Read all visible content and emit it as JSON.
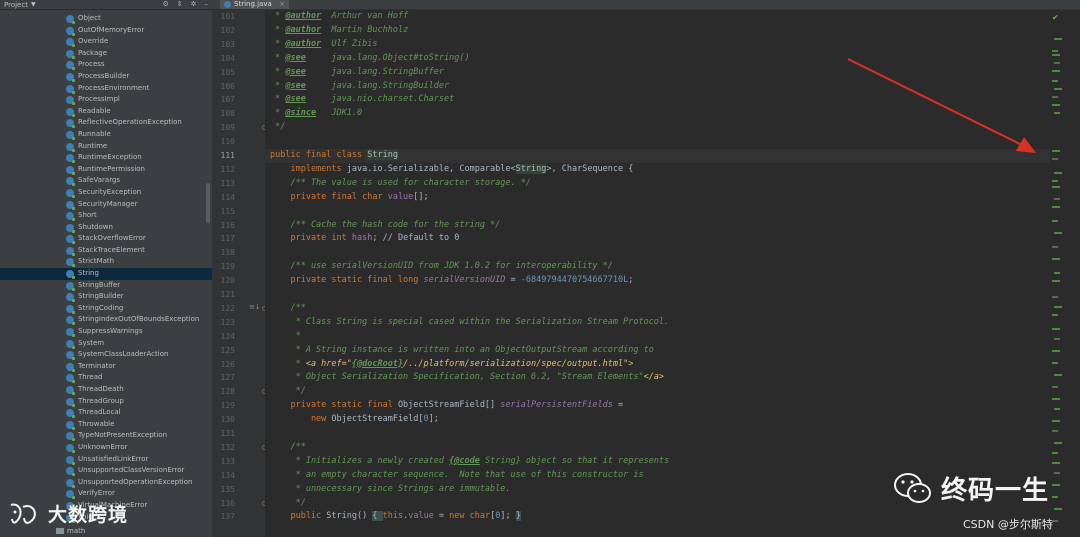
{
  "project": {
    "title": "Project",
    "tree_items": [
      "Object",
      "OutOfMemoryError",
      "Override",
      "Package",
      "Process",
      "ProcessBuilder",
      "ProcessEnvironment",
      "ProcessImpl",
      "Readable",
      "ReflectiveOperationException",
      "Runnable",
      "Runtime",
      "RuntimeException",
      "RuntimePermission",
      "SafeVarargs",
      "SecurityException",
      "SecurityManager",
      "Short",
      "Shutdown",
      "StackOverflowError",
      "StackTraceElement",
      "StrictMath",
      "String",
      "StringBuffer",
      "StringBuilder",
      "StringCoding",
      "StringIndexOutOfBoundsException",
      "SuppressWarnings",
      "System",
      "SystemClassLoaderAction",
      "Terminator",
      "Thread",
      "ThreadDeath",
      "ThreadGroup",
      "ThreadLocal",
      "Throwable",
      "TypeNotPresentException",
      "UnknownError",
      "UnsatisfiedLinkError",
      "UnsupportedClassVersionError",
      "UnsupportedOperationException",
      "VerifyError",
      "VirtualMachineError",
      "Void"
    ],
    "selected": "String",
    "folder_math": "math"
  },
  "tab": {
    "label": "String.java"
  },
  "code_lines": [
    {
      "n": "101",
      "segments": [
        {
          "t": " * ",
          "c": "c-doc"
        },
        {
          "t": "@author",
          "c": "c-tag"
        },
        {
          "t": "  Arthur van Hoff",
          "c": "c-doc"
        }
      ]
    },
    {
      "n": "102",
      "segments": [
        {
          "t": " * ",
          "c": "c-doc"
        },
        {
          "t": "@author",
          "c": "c-tag"
        },
        {
          "t": "  Martin Buchholz",
          "c": "c-doc"
        }
      ]
    },
    {
      "n": "103",
      "segments": [
        {
          "t": " * ",
          "c": "c-doc"
        },
        {
          "t": "@author",
          "c": "c-tag"
        },
        {
          "t": "  Ulf Zibis",
          "c": "c-doc"
        }
      ]
    },
    {
      "n": "104",
      "segments": [
        {
          "t": " * ",
          "c": "c-doc"
        },
        {
          "t": "@see",
          "c": "c-tag"
        },
        {
          "t": "     java.lang.Object#toString()",
          "c": "c-doc"
        }
      ]
    },
    {
      "n": "105",
      "segments": [
        {
          "t": " * ",
          "c": "c-doc"
        },
        {
          "t": "@see",
          "c": "c-tag"
        },
        {
          "t": "     java.lang.StringBuffer",
          "c": "c-doc"
        }
      ]
    },
    {
      "n": "106",
      "segments": [
        {
          "t": " * ",
          "c": "c-doc"
        },
        {
          "t": "@see",
          "c": "c-tag"
        },
        {
          "t": "     java.lang.StringBuilder",
          "c": "c-doc"
        }
      ]
    },
    {
      "n": "107",
      "segments": [
        {
          "t": " * ",
          "c": "c-doc"
        },
        {
          "t": "@see",
          "c": "c-tag"
        },
        {
          "t": "     java.nio.charset.Charset",
          "c": "c-doc"
        }
      ]
    },
    {
      "n": "108",
      "segments": [
        {
          "t": " * ",
          "c": "c-doc"
        },
        {
          "t": "@since",
          "c": "c-tag"
        },
        {
          "t": "   JDK1.0",
          "c": "c-doc"
        }
      ]
    },
    {
      "n": "109",
      "segments": [
        {
          "t": " */",
          "c": "c-doc"
        }
      ]
    },
    {
      "n": "110",
      "segments": []
    },
    {
      "n": "111",
      "current": true,
      "segments": [
        {
          "t": "public final class ",
          "c": "c-kw"
        },
        {
          "t": "String",
          "c": "c-hl"
        }
      ]
    },
    {
      "n": "112",
      "segments": [
        {
          "t": "    implements ",
          "c": "c-kw"
        },
        {
          "t": "java.io.Serializable, Comparable<",
          "c": "c-cls"
        },
        {
          "t": "String",
          "c": "c-hl"
        },
        {
          "t": ">, CharSequence {",
          "c": "c-cls"
        }
      ]
    },
    {
      "n": "113",
      "segments": [
        {
          "t": "    /** The value is used for character storage. */",
          "c": "c-doc"
        }
      ]
    },
    {
      "n": "114",
      "segments": [
        {
          "t": "    private final char ",
          "c": "c-kw"
        },
        {
          "t": "value",
          "c": "c-field"
        },
        {
          "t": "[];",
          "c": "c-cls"
        }
      ]
    },
    {
      "n": "115",
      "segments": []
    },
    {
      "n": "116",
      "segments": [
        {
          "t": "    /** Cache the hash code for the string */",
          "c": "c-doc"
        }
      ]
    },
    {
      "n": "117",
      "segments": [
        {
          "t": "    private int ",
          "c": "c-kw"
        },
        {
          "t": "hash",
          "c": "c-field"
        },
        {
          "t": "; // Default to 0",
          "c": "c-cls"
        }
      ]
    },
    {
      "n": "118",
      "segments": []
    },
    {
      "n": "119",
      "segments": [
        {
          "t": "    /** use serialVersionUID from JDK 1.0.2 for interoperability */",
          "c": "c-doc"
        }
      ]
    },
    {
      "n": "120",
      "segments": [
        {
          "t": "    private static final long ",
          "c": "c-kw"
        },
        {
          "t": "serialVersionUID",
          "c": "c-sfield"
        },
        {
          "t": " = ",
          "c": "c-cls"
        },
        {
          "t": "-6849794470754667710L",
          "c": "c-num"
        },
        {
          "t": ";",
          "c": "c-cls"
        }
      ]
    },
    {
      "n": "121",
      "segments": []
    },
    {
      "n": "122",
      "segments": [
        {
          "t": "    /**",
          "c": "c-doc"
        }
      ]
    },
    {
      "n": "123",
      "segments": [
        {
          "t": "     * Class String is special cased within the Serialization Stream Protocol.",
          "c": "c-doc"
        }
      ]
    },
    {
      "n": "124",
      "segments": [
        {
          "t": "     *",
          "c": "c-doc"
        }
      ]
    },
    {
      "n": "125",
      "segments": [
        {
          "t": "     * A String instance is written into an ObjectOutputStream according to",
          "c": "c-doc"
        }
      ]
    },
    {
      "n": "126",
      "segments": [
        {
          "t": "     * ",
          "c": "c-doc"
        },
        {
          "t": "<a href=\"",
          "c": "c-htmltag"
        },
        {
          "t": "{@docRoot}",
          "c": "c-tag"
        },
        {
          "t": "/../platform/serialization/spec/output.html\">",
          "c": "c-htmltag"
        }
      ]
    },
    {
      "n": "127",
      "segments": [
        {
          "t": "     * Object Serialization Specification, Section 6.2, \"Stream Elements\"",
          "c": "c-doc"
        },
        {
          "t": "</a>",
          "c": "c-htmltag"
        }
      ]
    },
    {
      "n": "128",
      "segments": [
        {
          "t": "     */",
          "c": "c-doc"
        }
      ]
    },
    {
      "n": "129",
      "segments": [
        {
          "t": "    private static final ",
          "c": "c-kw"
        },
        {
          "t": "ObjectStreamField[] ",
          "c": "c-cls"
        },
        {
          "t": "serialPersistentFields",
          "c": "c-sfield"
        },
        {
          "t": " =",
          "c": "c-cls"
        }
      ]
    },
    {
      "n": "130",
      "segments": [
        {
          "t": "        new ",
          "c": "c-kw"
        },
        {
          "t": "ObjectStreamField[",
          "c": "c-cls"
        },
        {
          "t": "0",
          "c": "c-num"
        },
        {
          "t": "];",
          "c": "c-cls"
        }
      ]
    },
    {
      "n": "131",
      "segments": []
    },
    {
      "n": "132",
      "segments": [
        {
          "t": "    /**",
          "c": "c-doc"
        }
      ]
    },
    {
      "n": "133",
      "segments": [
        {
          "t": "     * Initializes a newly created ",
          "c": "c-doc"
        },
        {
          "t": "{@code",
          "c": "c-tag"
        },
        {
          "t": " String} object so that it represents",
          "c": "c-doc"
        }
      ]
    },
    {
      "n": "134",
      "segments": [
        {
          "t": "     * an empty character sequence.  Note that use of this constructor is",
          "c": "c-doc"
        }
      ]
    },
    {
      "n": "135",
      "segments": [
        {
          "t": "     * unnecessary since Strings are immutable.",
          "c": "c-doc"
        }
      ]
    },
    {
      "n": "136",
      "segments": [
        {
          "t": "     */",
          "c": "c-doc"
        }
      ]
    },
    {
      "n": "137",
      "segments": [
        {
          "t": "    public ",
          "c": "c-kw"
        },
        {
          "t": "String() ",
          "c": "c-cls"
        },
        {
          "t": "{ ",
          "c": "c-brace"
        },
        {
          "t": "this",
          "c": "c-kw"
        },
        {
          "t": ".",
          "c": "c-cls"
        },
        {
          "t": "value",
          "c": "c-field"
        },
        {
          "t": " = ",
          "c": "c-cls"
        },
        {
          "t": "new char",
          "c": "c-kw"
        },
        {
          "t": "[",
          "c": "c-cls"
        },
        {
          "t": "0",
          "c": "c-num"
        },
        {
          "t": "]; ",
          "c": "c-cls"
        },
        {
          "t": "}",
          "c": "c-brace"
        }
      ]
    }
  ],
  "watermarks": {
    "left_text": "大数跨境",
    "right_text": "终码一生",
    "csdn": "CSDN @步尔斯特"
  },
  "colors": {
    "arrow": "#d93025",
    "accent_green": "#62b543"
  }
}
